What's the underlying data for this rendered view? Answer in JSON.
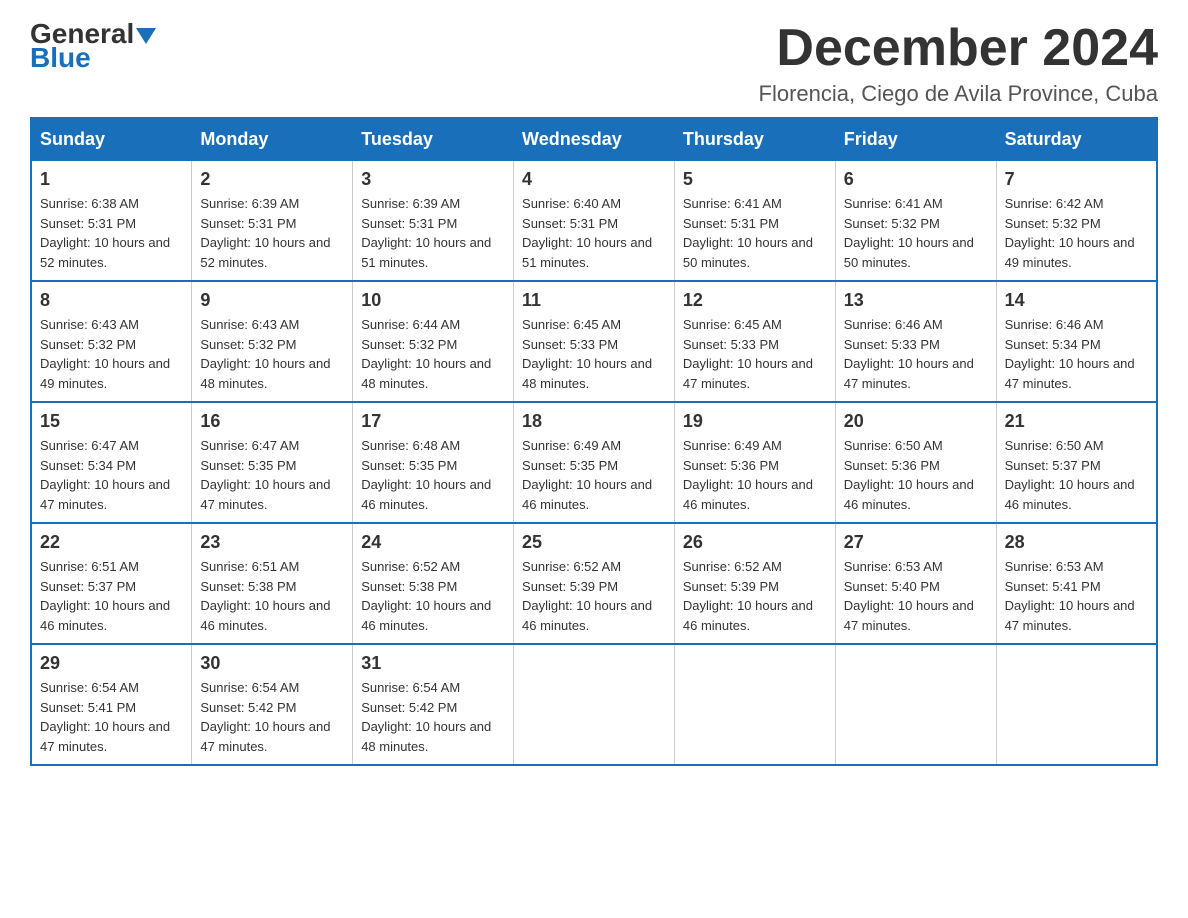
{
  "logo": {
    "general": "General",
    "blue": "Blue"
  },
  "title": {
    "month_year": "December 2024",
    "location": "Florencia, Ciego de Avila Province, Cuba"
  },
  "headers": [
    "Sunday",
    "Monday",
    "Tuesday",
    "Wednesday",
    "Thursday",
    "Friday",
    "Saturday"
  ],
  "weeks": [
    [
      {
        "day": "1",
        "sunrise": "6:38 AM",
        "sunset": "5:31 PM",
        "daylight": "10 hours and 52 minutes."
      },
      {
        "day": "2",
        "sunrise": "6:39 AM",
        "sunset": "5:31 PM",
        "daylight": "10 hours and 52 minutes."
      },
      {
        "day": "3",
        "sunrise": "6:39 AM",
        "sunset": "5:31 PM",
        "daylight": "10 hours and 51 minutes."
      },
      {
        "day": "4",
        "sunrise": "6:40 AM",
        "sunset": "5:31 PM",
        "daylight": "10 hours and 51 minutes."
      },
      {
        "day": "5",
        "sunrise": "6:41 AM",
        "sunset": "5:31 PM",
        "daylight": "10 hours and 50 minutes."
      },
      {
        "day": "6",
        "sunrise": "6:41 AM",
        "sunset": "5:32 PM",
        "daylight": "10 hours and 50 minutes."
      },
      {
        "day": "7",
        "sunrise": "6:42 AM",
        "sunset": "5:32 PM",
        "daylight": "10 hours and 49 minutes."
      }
    ],
    [
      {
        "day": "8",
        "sunrise": "6:43 AM",
        "sunset": "5:32 PM",
        "daylight": "10 hours and 49 minutes."
      },
      {
        "day": "9",
        "sunrise": "6:43 AM",
        "sunset": "5:32 PM",
        "daylight": "10 hours and 48 minutes."
      },
      {
        "day": "10",
        "sunrise": "6:44 AM",
        "sunset": "5:32 PM",
        "daylight": "10 hours and 48 minutes."
      },
      {
        "day": "11",
        "sunrise": "6:45 AM",
        "sunset": "5:33 PM",
        "daylight": "10 hours and 48 minutes."
      },
      {
        "day": "12",
        "sunrise": "6:45 AM",
        "sunset": "5:33 PM",
        "daylight": "10 hours and 47 minutes."
      },
      {
        "day": "13",
        "sunrise": "6:46 AM",
        "sunset": "5:33 PM",
        "daylight": "10 hours and 47 minutes."
      },
      {
        "day": "14",
        "sunrise": "6:46 AM",
        "sunset": "5:34 PM",
        "daylight": "10 hours and 47 minutes."
      }
    ],
    [
      {
        "day": "15",
        "sunrise": "6:47 AM",
        "sunset": "5:34 PM",
        "daylight": "10 hours and 47 minutes."
      },
      {
        "day": "16",
        "sunrise": "6:47 AM",
        "sunset": "5:35 PM",
        "daylight": "10 hours and 47 minutes."
      },
      {
        "day": "17",
        "sunrise": "6:48 AM",
        "sunset": "5:35 PM",
        "daylight": "10 hours and 46 minutes."
      },
      {
        "day": "18",
        "sunrise": "6:49 AM",
        "sunset": "5:35 PM",
        "daylight": "10 hours and 46 minutes."
      },
      {
        "day": "19",
        "sunrise": "6:49 AM",
        "sunset": "5:36 PM",
        "daylight": "10 hours and 46 minutes."
      },
      {
        "day": "20",
        "sunrise": "6:50 AM",
        "sunset": "5:36 PM",
        "daylight": "10 hours and 46 minutes."
      },
      {
        "day": "21",
        "sunrise": "6:50 AM",
        "sunset": "5:37 PM",
        "daylight": "10 hours and 46 minutes."
      }
    ],
    [
      {
        "day": "22",
        "sunrise": "6:51 AM",
        "sunset": "5:37 PM",
        "daylight": "10 hours and 46 minutes."
      },
      {
        "day": "23",
        "sunrise": "6:51 AM",
        "sunset": "5:38 PM",
        "daylight": "10 hours and 46 minutes."
      },
      {
        "day": "24",
        "sunrise": "6:52 AM",
        "sunset": "5:38 PM",
        "daylight": "10 hours and 46 minutes."
      },
      {
        "day": "25",
        "sunrise": "6:52 AM",
        "sunset": "5:39 PM",
        "daylight": "10 hours and 46 minutes."
      },
      {
        "day": "26",
        "sunrise": "6:52 AM",
        "sunset": "5:39 PM",
        "daylight": "10 hours and 46 minutes."
      },
      {
        "day": "27",
        "sunrise": "6:53 AM",
        "sunset": "5:40 PM",
        "daylight": "10 hours and 47 minutes."
      },
      {
        "day": "28",
        "sunrise": "6:53 AM",
        "sunset": "5:41 PM",
        "daylight": "10 hours and 47 minutes."
      }
    ],
    [
      {
        "day": "29",
        "sunrise": "6:54 AM",
        "sunset": "5:41 PM",
        "daylight": "10 hours and 47 minutes."
      },
      {
        "day": "30",
        "sunrise": "6:54 AM",
        "sunset": "5:42 PM",
        "daylight": "10 hours and 47 minutes."
      },
      {
        "day": "31",
        "sunrise": "6:54 AM",
        "sunset": "5:42 PM",
        "daylight": "10 hours and 48 minutes."
      },
      null,
      null,
      null,
      null
    ]
  ]
}
